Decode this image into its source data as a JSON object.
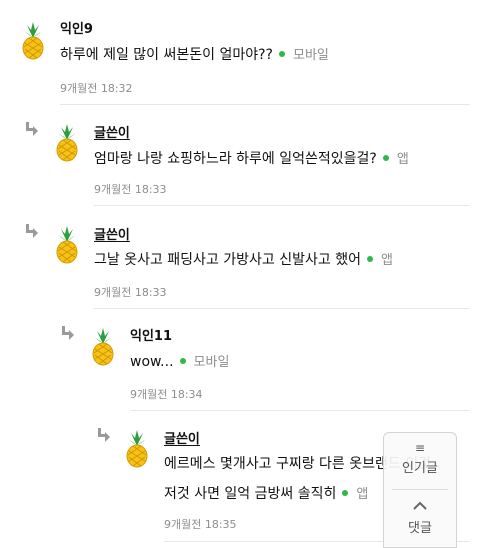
{
  "comments": [
    {
      "nick": "익인9",
      "text": "하루에 제일 많이 써본돈이 얼마야??",
      "source": "모바일",
      "time": "9개월전 18:32"
    },
    {
      "nick": "글쓴이",
      "text": "엄마랑 나랑 쇼핑하느라 하루에 일억쓴적있을걸?",
      "source": "앱",
      "time": "9개월전 18:33"
    },
    {
      "nick": "글쓴이",
      "text": "그날 옷사고 패딩사고 가방사고 신발사고 했어",
      "source": "앱",
      "time": "9개월전 18:33"
    },
    {
      "nick": "익인11",
      "text": "wow...",
      "source": "모바일",
      "time": "9개월전 18:34"
    },
    {
      "nick": "글쓴이",
      "text_line1": "에르메스 몇개사고 구찌랑 다른 옷브랜드 이것",
      "text_line2": "저것 사면 일억 금방써 솔직히",
      "source": "앱",
      "time": "9개월전 18:35"
    }
  ],
  "side_panel": {
    "menu_icon": "≡",
    "popular_label": "인기글",
    "up_icon": "chevron-up-icon",
    "comments_label": "댓글"
  },
  "colors": {
    "online_dot": "#2fb84a",
    "meta_text": "#8e8e8e"
  }
}
